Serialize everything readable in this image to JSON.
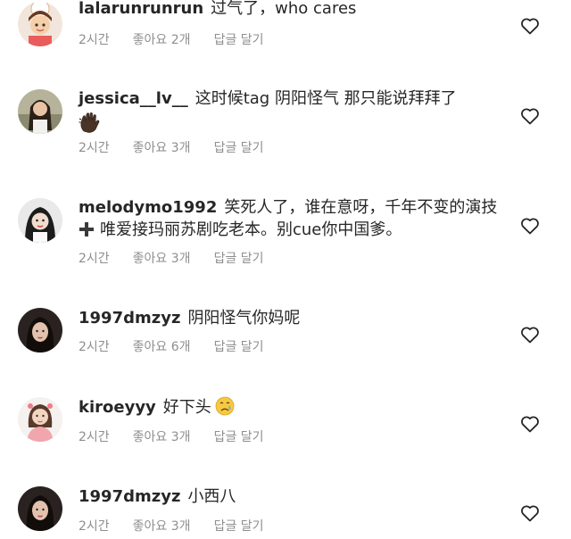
{
  "comments": [
    {
      "username": "lalarunrunrun",
      "text": "过气了，who cares",
      "time": "2시간",
      "likes": "좋아요 2개",
      "reply": "답글 달기"
    },
    {
      "username": "jessica__lv__",
      "text": "这时候tag 阴阳怪气 那只能说拜拜了",
      "emoji": "waving-hand",
      "time": "2시간",
      "likes": "좋아요 3개",
      "reply": "답글 달기"
    },
    {
      "username": "melodymo1992",
      "text": "笑死人了，谁在意呀，千年不变的演技",
      "text_line2": "唯爱接玛丽苏剧吃老本。别cue你中国爹。",
      "time": "2시간",
      "likes": "좋아요 3개",
      "reply": "답글 달기"
    },
    {
      "username": "1997dmzyz",
      "text": "阴阳怪气你妈呢",
      "time": "2시간",
      "likes": "좋아요 6개",
      "reply": "답글 달기"
    },
    {
      "username": "kiroeyyy",
      "text": "好下头",
      "emoji": "crying-face",
      "time": "2시간",
      "likes": "좋아요 3개",
      "reply": "답글 달기"
    },
    {
      "username": "1997dmzyz",
      "text": "小西八",
      "time": "2시간",
      "likes": "좋아요 3개",
      "reply": "답글 달기"
    }
  ],
  "colors": {
    "text": "#262626",
    "meta": "#8e8e8e",
    "background": "#ffffff"
  }
}
